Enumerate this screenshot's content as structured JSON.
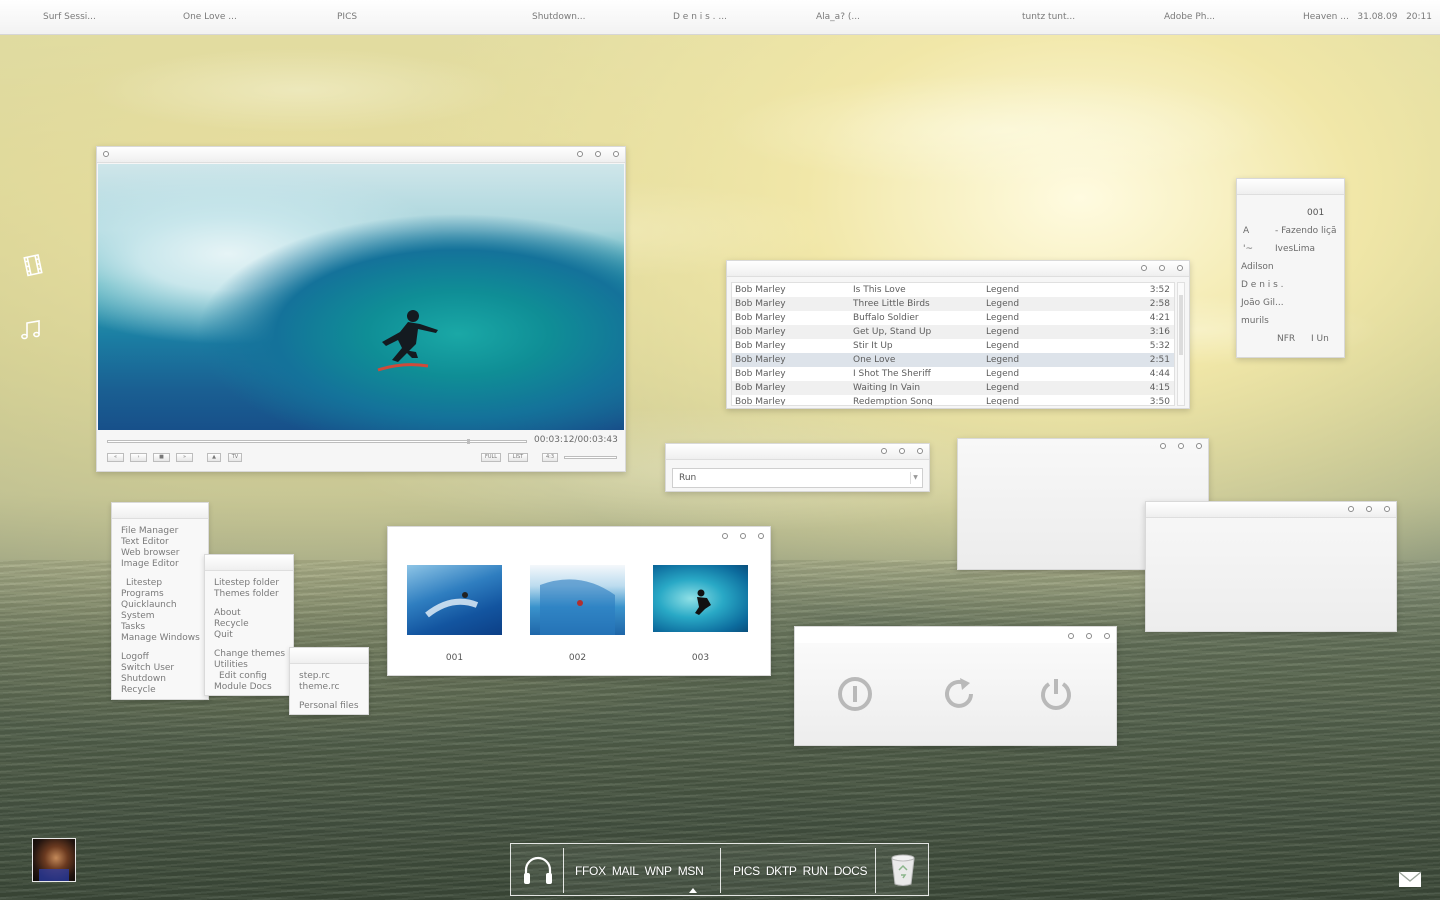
{
  "topbar": {
    "tasks": [
      "Surf Sessi...",
      "One Love ...",
      "PICS",
      "Shutdown...",
      "D e n i s . ...",
      "Ala_a? (...",
      "tuntz tunt...",
      "Adobe Ph...",
      "Heaven ..."
    ],
    "date": "31.08.09",
    "time": "20:11"
  },
  "media_player": {
    "time_readout": "00:03:12/00:03:43",
    "progress": 0.86,
    "buttons": [
      "«",
      "›",
      "■",
      "»",
      "▲",
      "TV",
      "FULL",
      "LIST",
      "4:3"
    ]
  },
  "playlist": {
    "rows": [
      {
        "artist": "Bob Marley",
        "title": "Is This Love",
        "album": "Legend",
        "length": "3:52"
      },
      {
        "artist": "Bob Marley",
        "title": "Three Little Birds",
        "album": "Legend",
        "length": "2:58"
      },
      {
        "artist": "Bob Marley",
        "title": "Buffalo Soldier",
        "album": "Legend",
        "length": "4:21"
      },
      {
        "artist": "Bob Marley",
        "title": "Get Up, Stand Up",
        "album": "Legend",
        "length": "3:16"
      },
      {
        "artist": "Bob Marley",
        "title": "Stir It Up",
        "album": "Legend",
        "length": "5:32"
      },
      {
        "artist": "Bob Marley",
        "title": "One Love",
        "album": "Legend",
        "length": "2:51"
      },
      {
        "artist": "Bob Marley",
        "title": "I Shot The Sheriff",
        "album": "Legend",
        "length": "4:44"
      },
      {
        "artist": "Bob Marley",
        "title": "Waiting In Vain",
        "album": "Legend",
        "length": "4:15"
      },
      {
        "artist": "Bob Marley",
        "title": "Redemption Song",
        "album": "Legend",
        "length": "3:50"
      }
    ],
    "selected_index": 5
  },
  "contacts": {
    "title": "001",
    "lines": [
      "A",
      "- Fazendo liçã",
      "'~",
      "IvesLima",
      "Adilson",
      "D e n i s .",
      "João Gil...",
      "murils"
    ],
    "footer_left": "NFR",
    "footer_right": "I Un"
  },
  "run_dialog": {
    "value": "Run"
  },
  "image_viewer": {
    "thumbs": [
      "001",
      "002",
      "003"
    ]
  },
  "power_dialog": {
    "icons": [
      "logoff-icon",
      "restart-icon",
      "shutdown-icon"
    ]
  },
  "menu_main": {
    "group1": [
      "File Manager",
      "Text Editor",
      "Web browser",
      "Image Editor"
    ],
    "group2": [
      "Litestep",
      "Programs",
      "Quicklaunch",
      "System",
      "Tasks",
      "Manage Windows"
    ],
    "group3": [
      "Logoff",
      "Switch User",
      "Shutdown",
      "Recycle"
    ]
  },
  "menu_sub": {
    "group1": [
      "Litestep folder",
      "Themes folder"
    ],
    "group2": [
      "About",
      "Recycle",
      "Quit"
    ],
    "group3": [
      "Change themes",
      "Utilities",
      "Edit config",
      "Module Docs"
    ]
  },
  "menu_sub2": {
    "group1": [
      "step.rc",
      "theme.rc"
    ],
    "group2": [
      "Personal files"
    ]
  },
  "dock": {
    "group1": [
      "FFOX",
      "MAIL",
      "WNP",
      "MSN"
    ],
    "group2": [
      "PICS",
      "DKTP",
      "RUN",
      "DOCS"
    ]
  },
  "colors": {
    "window_bg": "#f6f6f6",
    "text": "#6b6b6b",
    "dock_text": "#ffffff"
  }
}
